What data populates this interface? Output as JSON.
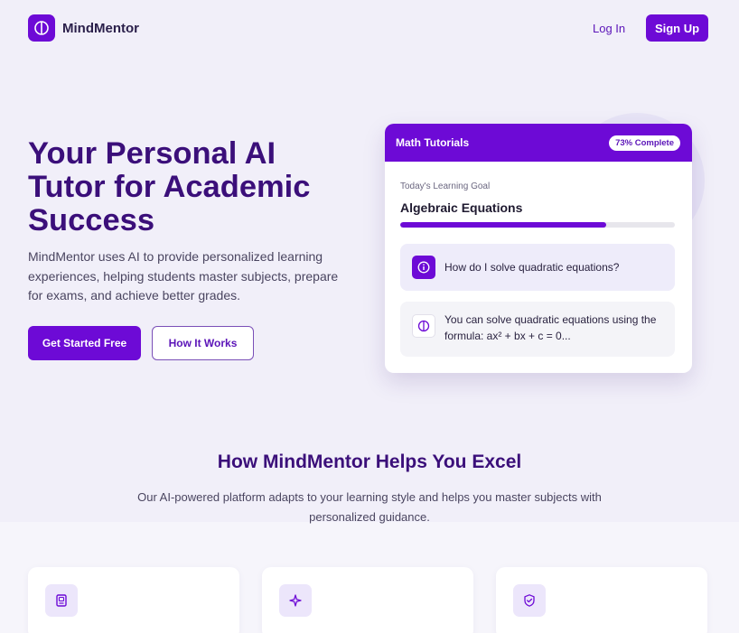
{
  "header": {
    "brand": "MindMentor",
    "login_label": "Log In",
    "signup_label": "Sign Up"
  },
  "hero": {
    "title": "Your Personal AI Tutor for Academic Success",
    "description": "MindMentor uses AI to provide personalized learning experiences, helping students master subjects, prepare for exams, and achieve better grades.",
    "primary_button": "Get Started Free",
    "secondary_button": "How It Works"
  },
  "tutorial_card": {
    "title": "Math Tutorials",
    "badge": "73% Complete",
    "goal_label": "Today's Learning Goal",
    "goal_title": "Algebraic Equations",
    "progress": 0.75,
    "question": "How do I solve quadratic equations?",
    "answer": "You can solve quadratic equations using the formula: ax² + bx + c = 0..."
  },
  "features_section": {
    "title": "How MindMentor Helps You Excel",
    "description": "Our AI-powered platform adapts to your learning style and helps you master subjects with personalized guidance.",
    "cards": [
      {
        "icon": "book-icon"
      },
      {
        "icon": "sparkle-icon"
      },
      {
        "icon": "shield-check-icon"
      }
    ]
  },
  "colors": {
    "brand": "#6d0ad6",
    "heading": "#3b0f7a",
    "background": "#f1eff9"
  }
}
